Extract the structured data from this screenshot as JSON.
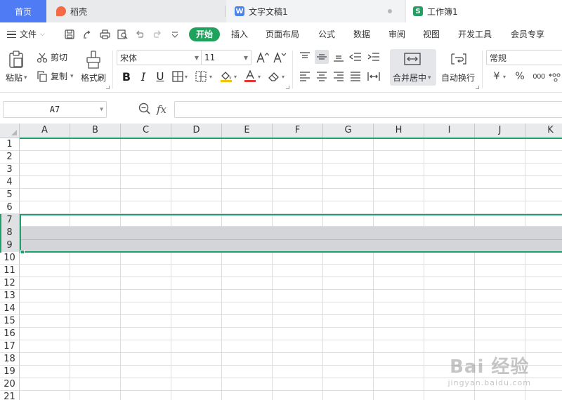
{
  "tabs": {
    "home": "首页",
    "daoke": "稻壳",
    "doc": "文字文稿1",
    "book": "工作簿1"
  },
  "menu": {
    "file": "文件",
    "start": "开始",
    "items": [
      "插入",
      "页面布局",
      "公式",
      "数据",
      "审阅",
      "视图",
      "开发工具",
      "会员专享"
    ]
  },
  "ribbon": {
    "paste": "粘贴",
    "cut": "剪切",
    "copy": "复制",
    "format_painter": "格式刷",
    "font_name": "宋体",
    "font_size": "11",
    "merge_center": "合并居中",
    "wrap_text": "自动换行",
    "number_format": "常规",
    "currency_symbol": "¥",
    "percent_symbol": "%",
    "thousands_symbol": "000"
  },
  "formula_bar": {
    "name_box": "A7",
    "fx": "fx",
    "content": ""
  },
  "grid": {
    "columns": [
      "A",
      "B",
      "C",
      "D",
      "E",
      "F",
      "G",
      "H",
      "I",
      "J",
      "K"
    ],
    "rows": [
      "1",
      "2",
      "3",
      "4",
      "5",
      "6",
      "7",
      "8",
      "9",
      "10",
      "11",
      "12",
      "13",
      "14",
      "15",
      "16",
      "17",
      "18",
      "19",
      "20",
      "21"
    ],
    "selected_rows": [
      "7",
      "8",
      "9"
    ],
    "active_cell": "A7"
  },
  "watermark": {
    "main": "Bai 经验",
    "sub": "jingyan.baidu.com"
  },
  "colors": {
    "accent_green": "#1fa25b",
    "tab_blue": "#4f7cf4",
    "selection_gray": "#d4d5d8"
  }
}
